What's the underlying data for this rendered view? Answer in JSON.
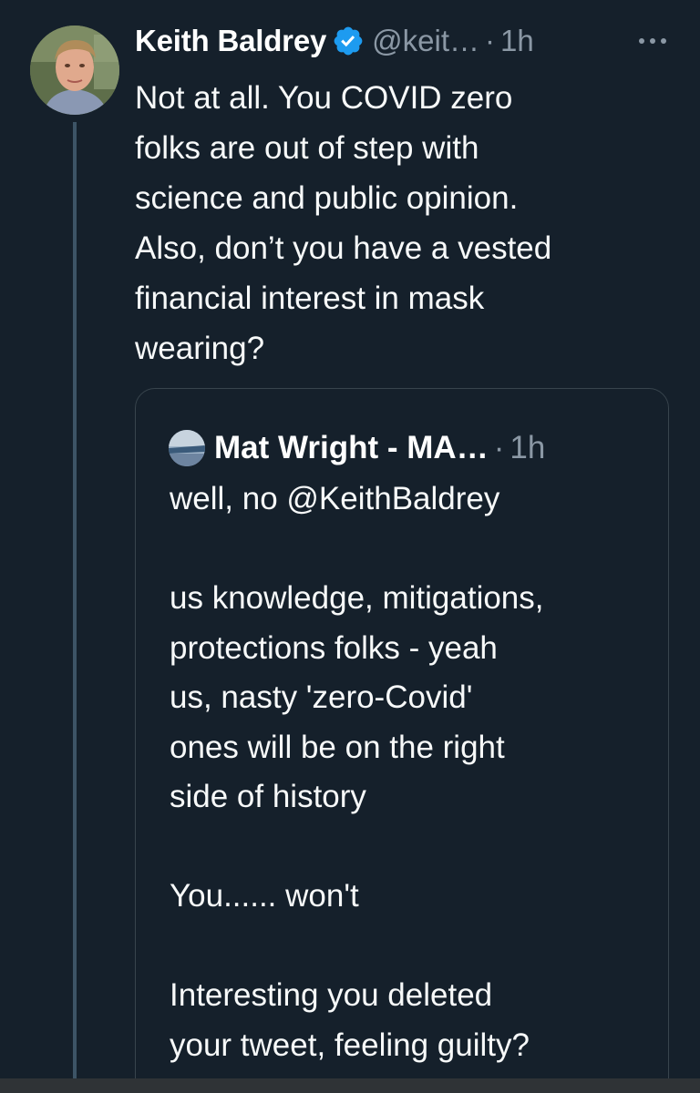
{
  "tweet": {
    "author": {
      "name": "Keith Baldrey",
      "handle": "@keit…",
      "separator": "·",
      "time": "1h",
      "verified": true,
      "avatar_icon": "person-avatar"
    },
    "more_icon": "more-dots-icon",
    "text": "Not at all. You COVID zero\nfolks are out of step with\nscience and public opinion.\nAlso, don’t you have a vested\nfinancial interest in mask\nwearing?"
  },
  "quoted_tweet": {
    "author": {
      "name": "Mat Wright - MA…",
      "separator": "·",
      "time": "1h",
      "avatar_icon": "landscape-avatar"
    },
    "text": "well, no @KeithBaldrey\n\nus knowledge, mitigations,\nprotections folks - yeah\nus, nasty 'zero-Covid'\nones will be on the right\nside of history\n\nYou...... won't\n\nInteresting you deleted\nyour tweet, feeling guilty?"
  },
  "colors": {
    "background": "#15202b",
    "text_primary": "#f7f9f9",
    "text_secondary": "#8b98a5",
    "verified_blue": "#1d9bf0",
    "border": "#38444d",
    "thread_line": "#3d5466"
  }
}
